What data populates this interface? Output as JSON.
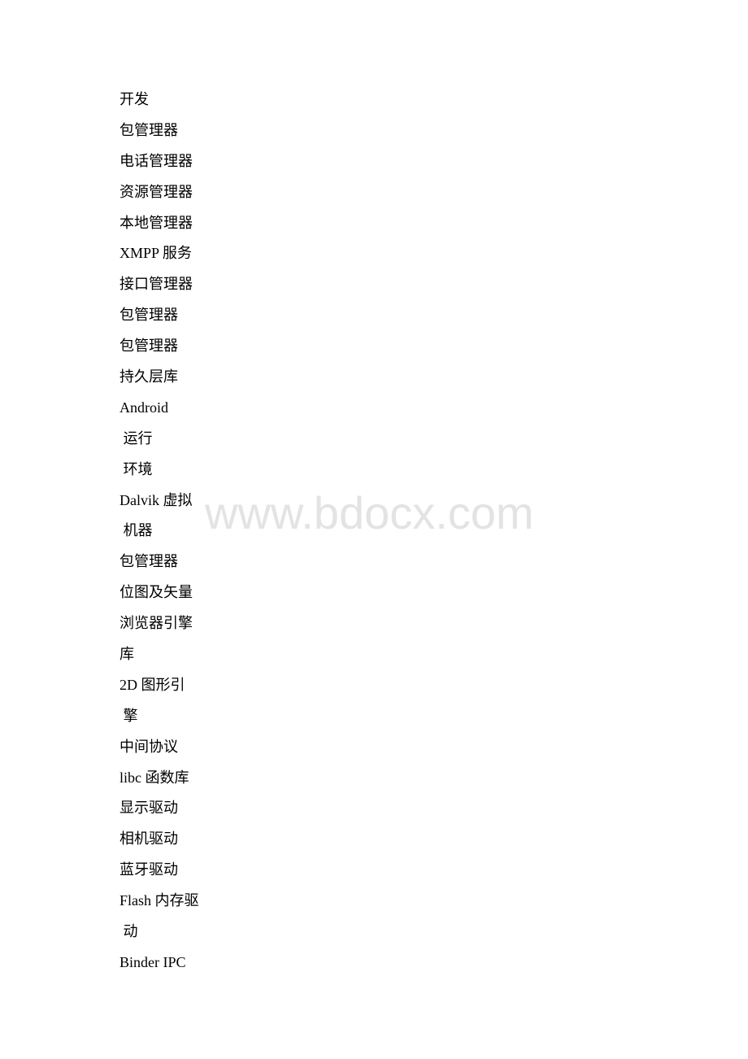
{
  "document": {
    "lines": [
      "开发",
      "包管理器",
      "电话管理器",
      "资源管理器",
      "本地管理器",
      "XMPP 服务",
      "接口管理器",
      "包管理器",
      "包管理器",
      "持久层库",
      "Android",
      " 运行",
      " 环境",
      "Dalvik 虚拟",
      " 机器",
      "包管理器",
      "位图及矢量",
      "浏览器引擎",
      "库",
      "2D 图形引",
      " 擎",
      "中间协议",
      "libc 函数库",
      "显示驱动",
      "相机驱动",
      "蓝牙驱动",
      "Flash 内存驱",
      " 动",
      "Binder IPC"
    ]
  },
  "watermark": {
    "text": "www.bdocx.com",
    "color": "#e3e3e3"
  }
}
